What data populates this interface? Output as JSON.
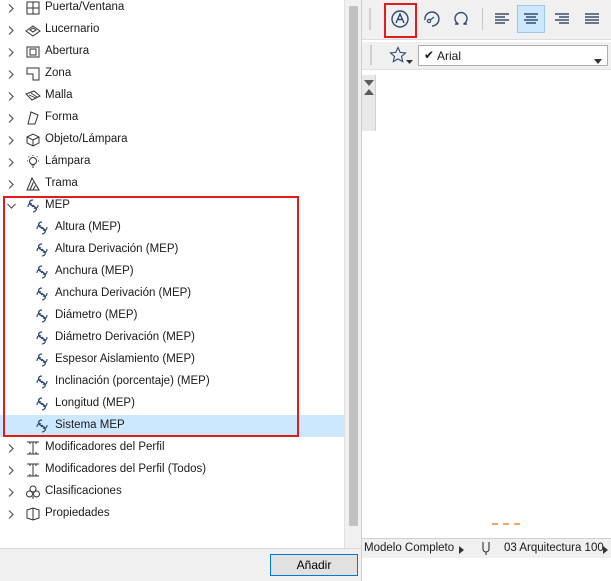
{
  "tree": {
    "items": [
      {
        "label": "Puerta/Ventana",
        "level": 0,
        "expanded": false,
        "icon": "door-window-icon"
      },
      {
        "label": "Lucernario",
        "level": 0,
        "expanded": false,
        "icon": "skylight-icon"
      },
      {
        "label": "Abertura",
        "level": 0,
        "expanded": false,
        "icon": "opening-icon"
      },
      {
        "label": "Zona",
        "level": 0,
        "expanded": false,
        "icon": "zone-icon"
      },
      {
        "label": "Malla",
        "level": 0,
        "expanded": false,
        "icon": "mesh-icon"
      },
      {
        "label": "Forma",
        "level": 0,
        "expanded": false,
        "icon": "shape-icon"
      },
      {
        "label": "Objeto/Lámpara",
        "level": 0,
        "expanded": false,
        "icon": "object-lamp-icon"
      },
      {
        "label": "Lámpara",
        "level": 0,
        "expanded": false,
        "icon": "lamp-icon"
      },
      {
        "label": "Trama",
        "level": 0,
        "expanded": false,
        "icon": "fill-pattern-icon"
      },
      {
        "label": "MEP",
        "level": 0,
        "expanded": true,
        "icon": "mep-icon"
      },
      {
        "label": "Altura (MEP)",
        "level": 1,
        "icon": "mep-icon"
      },
      {
        "label": "Altura Derivación (MEP)",
        "level": 1,
        "icon": "mep-icon"
      },
      {
        "label": "Anchura (MEP)",
        "level": 1,
        "icon": "mep-icon"
      },
      {
        "label": "Anchura Derivación (MEP)",
        "level": 1,
        "icon": "mep-icon"
      },
      {
        "label": "Diámetro (MEP)",
        "level": 1,
        "icon": "mep-icon"
      },
      {
        "label": "Diámetro Derivación (MEP)",
        "level": 1,
        "icon": "mep-icon"
      },
      {
        "label": "Espesor Aislamiento (MEP)",
        "level": 1,
        "icon": "mep-icon"
      },
      {
        "label": "Inclinación (porcentaje) (MEP)",
        "level": 1,
        "icon": "mep-icon"
      },
      {
        "label": "Longitud (MEP)",
        "level": 1,
        "icon": "mep-icon"
      },
      {
        "label": "Sistema MEP",
        "level": 1,
        "selected": true,
        "icon": "mep-icon"
      },
      {
        "label": "Modificadores del Perfil",
        "level": 0,
        "expanded": false,
        "icon": "profile-modifier-icon"
      },
      {
        "label": "Modificadores del Perfil (Todos)",
        "level": 0,
        "expanded": false,
        "icon": "profile-modifier-icon"
      },
      {
        "label": "Clasificaciones",
        "level": 0,
        "expanded": false,
        "icon": "classification-icon"
      },
      {
        "label": "Propiedades",
        "level": 0,
        "expanded": false,
        "icon": "properties-icon"
      }
    ]
  },
  "footer": {
    "add_label": "Añadir"
  },
  "font": {
    "name": "Arial"
  },
  "status": {
    "model_view": "Modelo Completo",
    "layer_combo": "03 Arquitectura 100"
  },
  "colors": {
    "highlight": "#e21b1b",
    "selection": "#cce8ff",
    "accent_border": "#0078d7"
  }
}
